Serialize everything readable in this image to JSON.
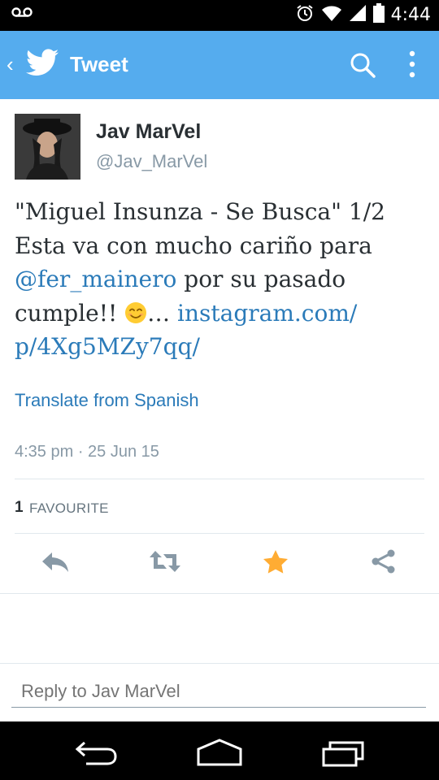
{
  "status_bar": {
    "time": "4:44",
    "icons": [
      "voicemail-icon",
      "alarm-icon",
      "wifi-icon",
      "signal-icon",
      "battery-icon"
    ]
  },
  "action_bar": {
    "title": "Tweet",
    "back_icon": "back-chevron-icon",
    "logo_icon": "twitter-bird-icon",
    "actions": [
      "search-icon",
      "overflow-menu-icon"
    ],
    "color": "#55ACEE"
  },
  "tweet": {
    "author_name": "Jav MarVel",
    "author_handle": "@Jav_MarVel",
    "text_line1": "\"Miguel Insunza - Se Busca\" 1/2",
    "text_line2": "Esta va con mucho cariño para",
    "mention": "@fer_mainero",
    "text_after_mention": " por su pasado",
    "text_line4_start": "cumple!! ",
    "ellipsis": "…",
    "link_part1": "instagram.com/",
    "link_part2": "p/4Xg5MZy7qq/",
    "translate": "Translate from Spanish",
    "timestamp": "4:35 pm · 25 Jun 15",
    "favourite_count": "1",
    "favourite_label": "FAVOURITE",
    "link_color": "#2b7bb9"
  },
  "tweet_actions": [
    "reply-icon",
    "retweet-icon",
    "favourite-star-icon",
    "share-icon"
  ],
  "reply": {
    "placeholder": "Reply to Jav MarVel"
  },
  "nav_bar": [
    "back-nav-icon",
    "home-nav-icon",
    "recents-nav-icon"
  ]
}
